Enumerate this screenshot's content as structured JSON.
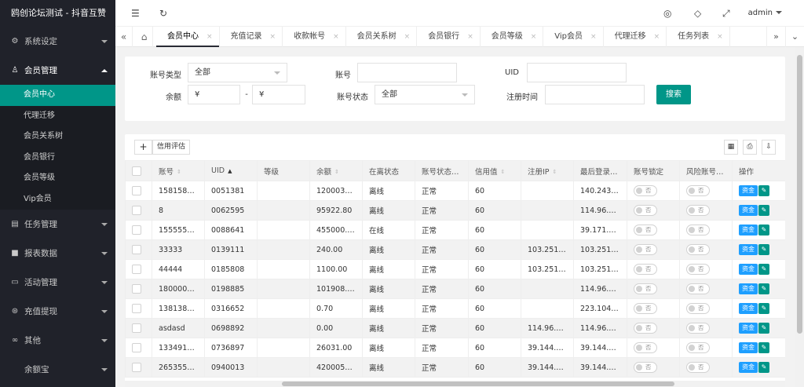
{
  "brand": "鸥创论坛测试 - 抖音互赞",
  "sidebar": {
    "groups": [
      {
        "label": "系统设定",
        "icon": "⚙"
      },
      {
        "label": "会员管理",
        "icon": "♙"
      },
      {
        "label": "任务管理",
        "icon": "▤"
      },
      {
        "label": "报表数据",
        "icon": "■"
      },
      {
        "label": "活动管理",
        "icon": "▭"
      },
      {
        "label": "充值提现",
        "icon": "⊛"
      },
      {
        "label": "其他",
        "icon": "∞"
      },
      {
        "label": "余额宝",
        "icon": ""
      }
    ],
    "sub_items": [
      "会员中心",
      "代理迁移",
      "会员关系树",
      "会员银行",
      "会员等级",
      "Vip会员"
    ]
  },
  "topbar": {
    "menu_icon": "☰",
    "refresh_icon": "↻",
    "theme_icon": "◎",
    "tag_icon": "◇",
    "fullscreen_icon": "⤢",
    "user": "admin"
  },
  "tabs": [
    {
      "label": "会员中心"
    },
    {
      "label": "充值记录"
    },
    {
      "label": "收款帐号"
    },
    {
      "label": "会员关系树"
    },
    {
      "label": "会员银行"
    },
    {
      "label": "会员等级"
    },
    {
      "label": "Vip会员"
    },
    {
      "label": "代理迁移"
    },
    {
      "label": "任务列表"
    }
  ],
  "tab_nav": {
    "left": "«",
    "home": "⌂",
    "right": "»",
    "more": "⌄",
    "close": "×"
  },
  "search": {
    "account_type_label": "账号类型",
    "account_type_value": "全部",
    "account_label": "账号",
    "uid_label": "UID",
    "balance_label": "余额",
    "balance_from_placeholder": "¥",
    "balance_to_placeholder": "¥",
    "range_sep": "-",
    "status_label": "账号状态",
    "status_value": "全部",
    "reg_time_label": "注册时间",
    "search_button": "搜索"
  },
  "toolbar": {
    "add_icon": "+",
    "credit_button": "信用评估",
    "columns_icon": "▦",
    "print_icon": "⎙",
    "export_icon": "⇩"
  },
  "table": {
    "columns": [
      "账号",
      "UID",
      "等级",
      "余额",
      "在离状态",
      "账号状态…",
      "信用值",
      "注册IP",
      "最后登录…",
      "账号锁定",
      "风险账号…",
      "操作"
    ],
    "toggle_label": "否",
    "fund_label": "资金",
    "edit_icon": "✎",
    "rows": [
      {
        "account": "1581581…",
        "uid": "0051381",
        "level": "",
        "balance": "1200031…",
        "online": "离线",
        "status": "正常",
        "credit": "60",
        "reg_ip": "",
        "last_login": "140.243.…"
      },
      {
        "account": "8",
        "uid": "0062595",
        "level": "",
        "balance": "95922.80",
        "online": "离线",
        "status": "正常",
        "credit": "60",
        "reg_ip": "",
        "last_login": "114.96.2…"
      },
      {
        "account": "1555555…",
        "uid": "0088641",
        "level": "",
        "balance": "455000.00",
        "online": "在线",
        "status": "正常",
        "credit": "60",
        "reg_ip": "",
        "last_login": "39.171.2…"
      },
      {
        "account": "33333",
        "uid": "0139111",
        "level": "",
        "balance": "240.00",
        "online": "离线",
        "status": "正常",
        "credit": "60",
        "reg_ip": "103.251.…",
        "last_login": "103.251.…"
      },
      {
        "account": "44444",
        "uid": "0185808",
        "level": "",
        "balance": "1100.00",
        "online": "离线",
        "status": "正常",
        "credit": "60",
        "reg_ip": "103.251.…",
        "last_login": "103.251.…"
      },
      {
        "account": "1800000…",
        "uid": "0198885",
        "level": "",
        "balance": "101908.00",
        "online": "离线",
        "status": "正常",
        "credit": "60",
        "reg_ip": "",
        "last_login": "114.96.2…"
      },
      {
        "account": "1381381…",
        "uid": "0316652",
        "level": "",
        "balance": "0.70",
        "online": "离线",
        "status": "正常",
        "credit": "60",
        "reg_ip": "",
        "last_login": "223.104.…"
      },
      {
        "account": "asdasd",
        "uid": "0698892",
        "level": "",
        "balance": "0.00",
        "online": "离线",
        "status": "正常",
        "credit": "60",
        "reg_ip": "114.96.1…",
        "last_login": "114.96.1…"
      },
      {
        "account": "1334915…",
        "uid": "0736897",
        "level": "",
        "balance": "26031.00",
        "online": "离线",
        "status": "正常",
        "credit": "60",
        "reg_ip": "39.144.1…",
        "last_login": "39.144.1…"
      },
      {
        "account": "2653556…",
        "uid": "0940013",
        "level": "",
        "balance": "4200055…",
        "online": "离线",
        "status": "正常",
        "credit": "60",
        "reg_ip": "39.144.1…",
        "last_login": "39.144.1…"
      }
    ]
  }
}
